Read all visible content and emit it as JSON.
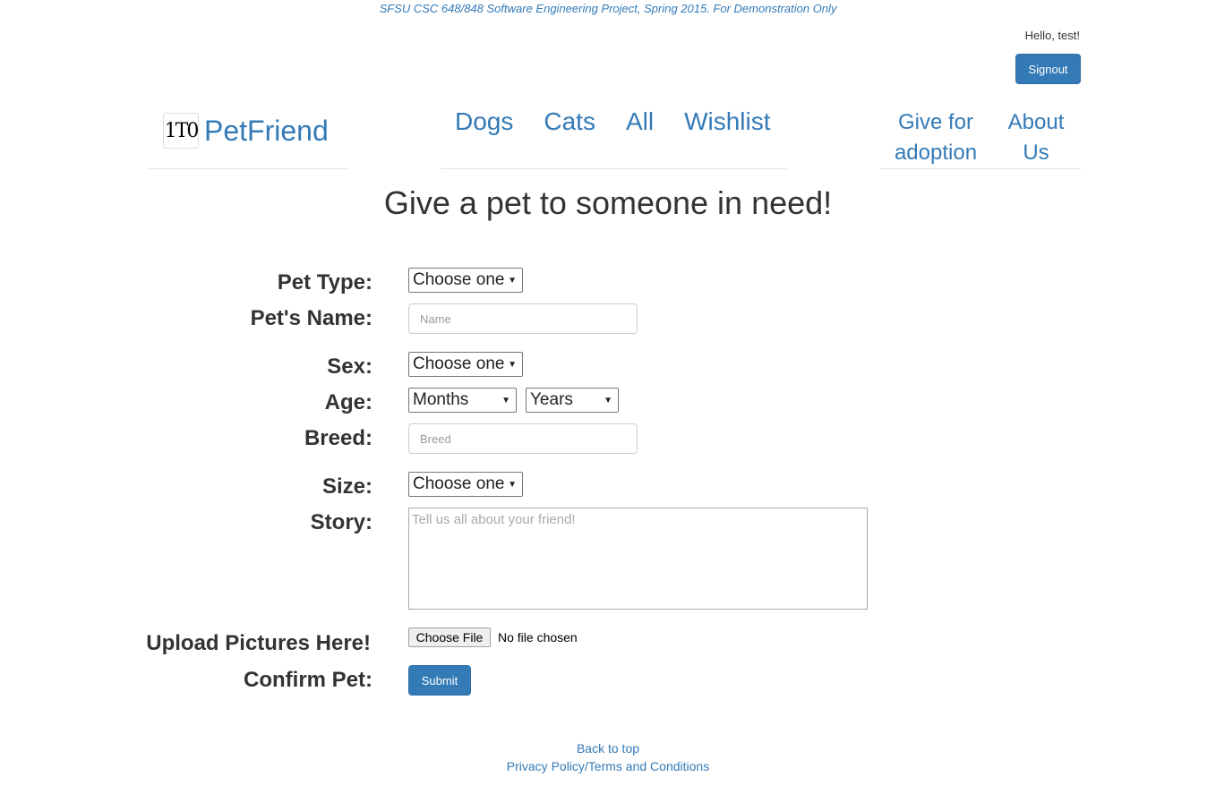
{
  "banner": "SFSU CSC 648/848 Software Engineering Project, Spring 2015. For Demonstration Only",
  "user": {
    "greeting": "Hello, test!",
    "signout_label": "Signout"
  },
  "brand": {
    "logo_text": "1T0",
    "name": "PetFriend"
  },
  "nav": {
    "dogs": "Dogs",
    "cats": "Cats",
    "all": "All",
    "wishlist": "Wishlist",
    "give_line1": "Give for",
    "give_line2": "adoption",
    "about_line1": "About",
    "about_line2": "Us"
  },
  "page_title": "Give a pet to someone in need!",
  "form": {
    "pet_type": {
      "label": "Pet Type:",
      "value": "Choose one"
    },
    "pet_name": {
      "label": "Pet's Name:",
      "placeholder": "Name"
    },
    "sex": {
      "label": "Sex:",
      "value": "Choose one"
    },
    "age": {
      "label": "Age:",
      "months_value": "Months",
      "years_value": "Years"
    },
    "breed": {
      "label": "Breed:",
      "placeholder": "Breed"
    },
    "size": {
      "label": "Size:",
      "value": "Choose one"
    },
    "story": {
      "label": "Story:",
      "placeholder": "Tell us all about your friend!"
    },
    "upload": {
      "label": "Upload Pictures Here!",
      "button": "Choose File",
      "status": "No file chosen"
    },
    "confirm": {
      "label": "Confirm Pet:",
      "submit": "Submit"
    }
  },
  "footer": {
    "back_to_top": "Back to top",
    "privacy": "Privacy Policy/Terms and Conditions"
  },
  "colors": {
    "link": "#337ab7",
    "button_primary": "#337ab7"
  }
}
